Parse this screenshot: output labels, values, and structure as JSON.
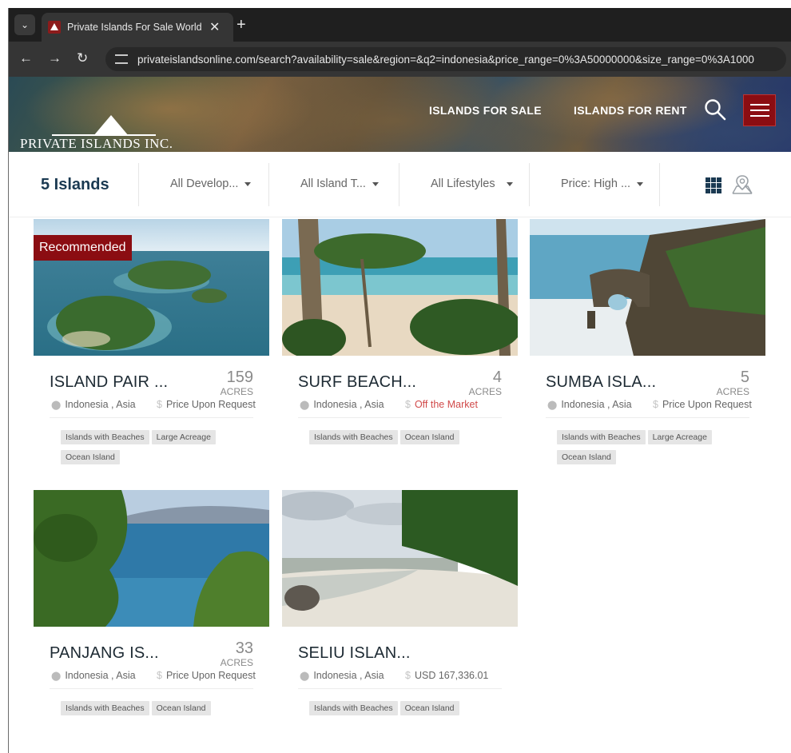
{
  "browser": {
    "tab_title": "Private Islands For Sale Worldwide",
    "url": "privateislandsonline.com/search?availability=sale&region=&q2=indonesia&price_range=0%3A50000000&size_range=0%3A1000"
  },
  "site": {
    "logo_text": "PRIVATE ISLANDS INC.",
    "nav": [
      "ISLANDS FOR SALE",
      "ISLANDS FOR RENT"
    ]
  },
  "filters": {
    "count": "5 Islands",
    "development": "All Develop...",
    "island_type": "All Island T...",
    "lifestyles": "All Lifestyles",
    "price_sort": "Price: High ..."
  },
  "cards": [
    {
      "badge": "Recommended",
      "title": "ISLAND PAIR ...",
      "acres": "159",
      "acres_label": "ACRES",
      "location": "Indonesia , Asia",
      "price": "Price Upon Request",
      "tags": [
        "Islands with Beaches",
        "Large Acreage",
        "Ocean Island"
      ]
    },
    {
      "title": "SURF BEACH...",
      "acres": "4",
      "acres_label": "ACRES",
      "location": "Indonesia , Asia",
      "price": "Off the Market",
      "tags": [
        "Islands with Beaches",
        "Ocean Island"
      ]
    },
    {
      "title": "SUMBA ISLA...",
      "acres": "5",
      "acres_label": "ACRES",
      "location": "Indonesia , Asia",
      "price": "Price Upon Request",
      "tags": [
        "Islands with Beaches",
        "Large Acreage",
        "Ocean Island"
      ]
    },
    {
      "title": "PANJANG IS...",
      "acres": "33",
      "acres_label": "ACRES",
      "location": "Indonesia , Asia",
      "price": "Price Upon Request",
      "tags": [
        "Islands with Beaches",
        "Ocean Island"
      ]
    },
    {
      "title": "SELIU ISLAN...",
      "location": "Indonesia , Asia",
      "price": "USD 167,336.01",
      "tags": [
        "Islands with Beaches",
        "Ocean Island"
      ]
    }
  ],
  "colors": {
    "brand_red": "#8b0d12",
    "navy": "#1b3a52",
    "off_market_red": "#d14a4a"
  }
}
